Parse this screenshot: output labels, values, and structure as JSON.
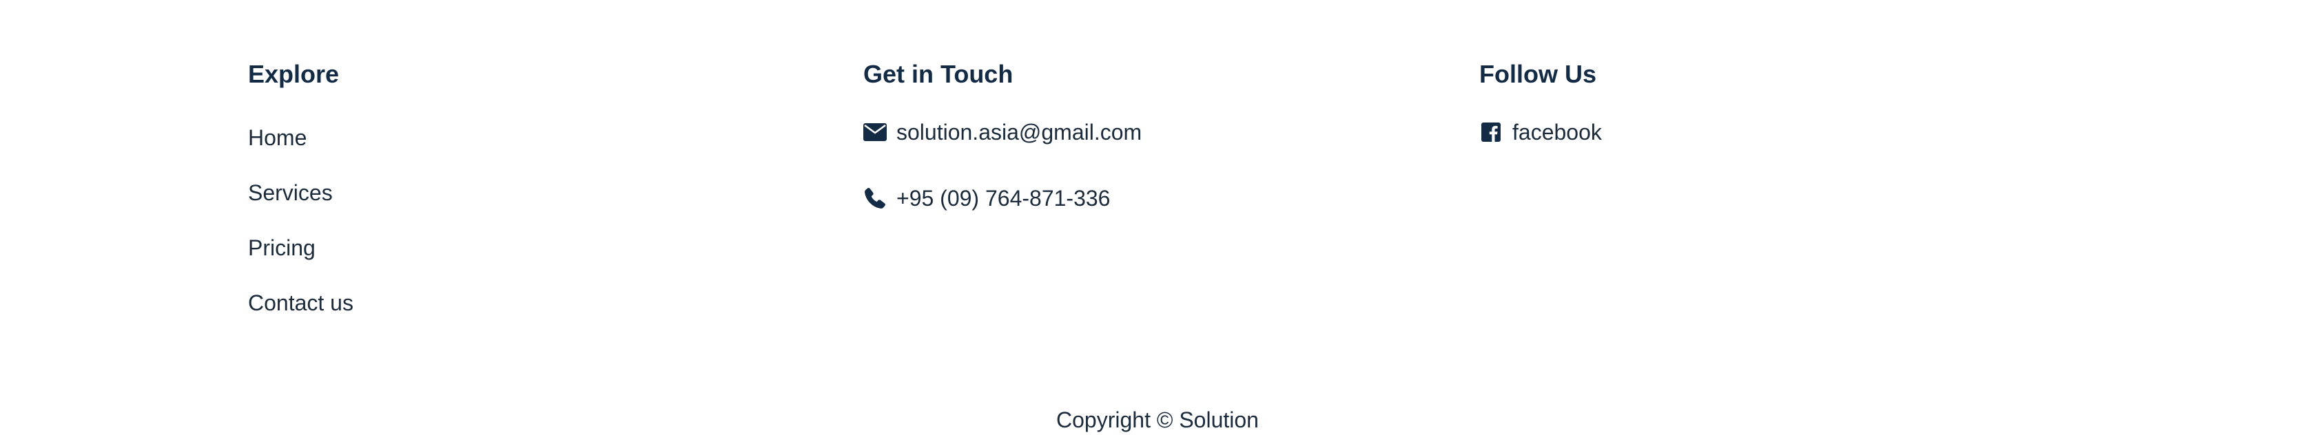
{
  "explore": {
    "heading": "Explore",
    "links": [
      {
        "label": "Home"
      },
      {
        "label": "Services"
      },
      {
        "label": "Pricing"
      },
      {
        "label": "Contact us"
      }
    ]
  },
  "contact": {
    "heading": "Get in Touch",
    "email": {
      "icon": "envelope-icon",
      "text": "solution.asia@gmail.com"
    },
    "phone": {
      "icon": "phone-icon",
      "text": "+95 (09) 764-871-336"
    }
  },
  "follow": {
    "heading": "Follow Us",
    "facebook": {
      "icon": "facebook-square-icon",
      "text": "facebook"
    }
  },
  "copyright": "Copyright © Solution",
  "colors": {
    "text": "#1c2b3c",
    "heading": "#132b45",
    "background": "#ffffff"
  }
}
